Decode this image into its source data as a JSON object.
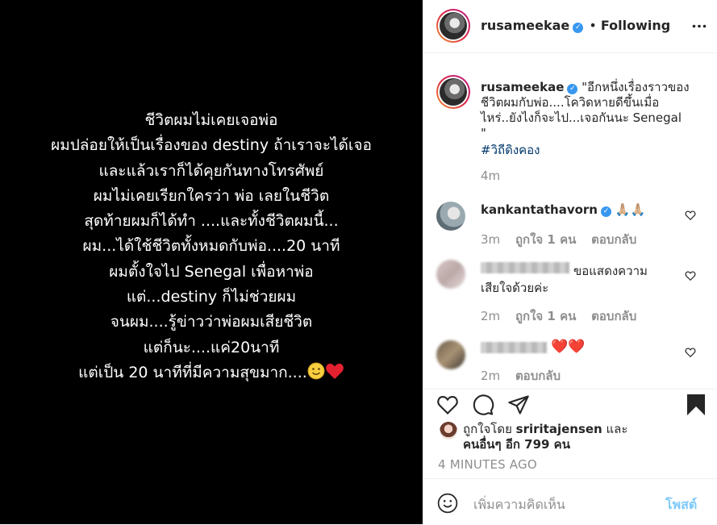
{
  "poem": {
    "lines": [
      "ชีวิตผมไม่เคยเจอพ่อ",
      "ผมปล่อยให้เป็นเรื่องของ destiny  ถ้าเราจะได้เจอ",
      "และแล้วเราก็ได้คุยกันทางโทรศัพย์",
      "ผมไม่เคยเรียกใครว่า พ่อ เลยในชีวิต",
      "สุดท้ายผมก็ได้ทำ ....และทั้งชีวิตผมนี้...",
      "ผม...ได้ใช้ชีวิตทั้งหมดกับพ่อ....20 นาที",
      "ผมตั้งใจไป Senegal เพื่อหาพ่อ",
      "แต่...destiny ก็ไม่ช่วยผม",
      "จนผม....รู้ข่าวว่าพ่อผมเสียชีวิต",
      "แต่ก็นะ....แค่20นาที",
      "แต่เป็น 20 นาทีที่มีความสุขมาก...."
    ]
  },
  "header": {
    "username": "rusameekae",
    "verified_icon": "verified-badge-icon",
    "separator": "•",
    "follow_label": "Following",
    "more_icon": "more-options-icon"
  },
  "caption": {
    "username": "rusameekae",
    "lines": [
      "\"อีกหนึ่งเรื่องราวของ",
      "ชีวิตผมกับพ่อ....โควิดหายดีขึ้นเมื่อ",
      "ไหร่..ยังไงก็จะไป...เจอกันนะ Senegal",
      "\""
    ],
    "hashtag": "#วิถีดิงคอง",
    "time": "4m"
  },
  "comments": [
    {
      "username": "kankantathavorn",
      "verified": true,
      "text": "🙏🏼🙏🏼",
      "time": "3m",
      "likes": "ถูกใจ 1 คน",
      "reply": "ตอบกลับ"
    },
    {
      "username": "",
      "text_line1": "ขอแสดงความ",
      "text_line2": "เสียใจด้วยค่ะ",
      "time": "2m",
      "likes": "ถูกใจ 1 คน",
      "reply": "ตอบกลับ"
    },
    {
      "username": "",
      "text": "❤️❤️",
      "time": "2m",
      "reply": "ตอบกลับ"
    }
  ],
  "likes": {
    "prefix": "ถูกใจโดย",
    "user": "sriritajensen",
    "and": "และ",
    "others": "คนอื่นๆ อีก 799 คน"
  },
  "timestamp": "4 MINUTES AGO",
  "add_comment": {
    "placeholder": "เพิ่มความคิดเห็น",
    "post_label": "โพสต์",
    "emoji_icon": "emoji-icon"
  },
  "colors": {
    "accent": "#0095f6",
    "verified": "#3897f0",
    "heart": "#ed4956",
    "link": "#00376b"
  }
}
